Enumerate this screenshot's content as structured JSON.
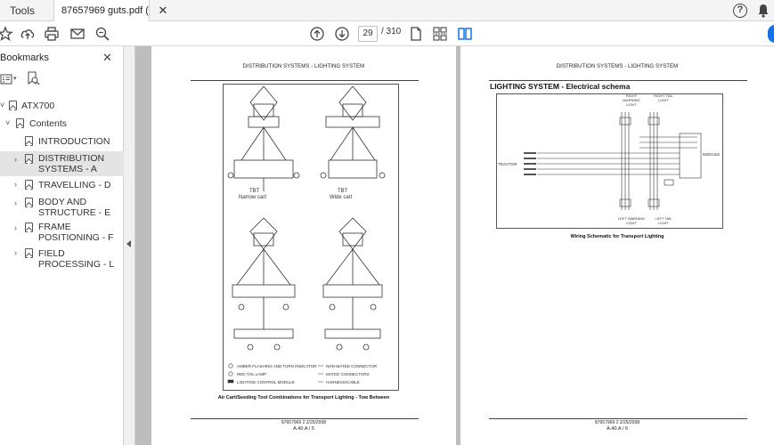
{
  "tabs": {
    "tools_label": "Tools",
    "document_label": "87657969 guts.pdf (..."
  },
  "toolbar": {
    "current_page": "29",
    "total_pages": "/ 310"
  },
  "sidebar": {
    "title": "Bookmarks",
    "items": [
      {
        "label": "ATX700"
      },
      {
        "label": "Contents"
      },
      {
        "label": "INTRODUCTION"
      },
      {
        "label": "DISTRIBUTION SYSTEMS - A"
      },
      {
        "label": "TRAVELLING - D"
      },
      {
        "label": "BODY AND STRUCTURE - E"
      },
      {
        "label": "FRAME POSITIONING - F"
      },
      {
        "label": "FIELD PROCESSING - L"
      }
    ]
  },
  "left_page": {
    "header": "DISTRIBUTION SYSTEMS - LIGHTING SYSTEM",
    "label_narrow_1": "TBT",
    "label_narrow_2": "Narrow cart",
    "label_wide_1": "TBT",
    "label_wide_2": "Wide cart",
    "legend": {
      "amber": "AMBER FLASHING AND TURN INDICATOR",
      "red": "RED TAIL LAMP",
      "module": "LIGHTING CONTROL MODULE",
      "non_mated": "NON-MATED CONNECTOR",
      "mated": "MATED CONNECTORS",
      "harness": "HARNESS/CABLE"
    },
    "caption": "Air Cart/Seeding Tool Combinations for Transport Lighting - Tow Between",
    "footer_code": "87657969 2 2/25/2008",
    "footer_page": "A.40.A / 5"
  },
  "right_page": {
    "header": "DISTRIBUTION SYSTEMS - LIGHTING SYSTEM",
    "section_title": "LIGHTING SYSTEM - Electrical schema",
    "labels": {
      "right_warning": "RIGHT WARNING LIGHT",
      "right_tail": "RIGHT TAIL LIGHT",
      "left_warning": "LEFT WARNING LIGHT",
      "left_tail": "LEFT TAIL LIGHT",
      "module": "MODULE",
      "tractor": "TRACTOR"
    },
    "caption": "Wiring Schematic for Transport Lighting",
    "footer_code": "87657969 2 2/25/2008",
    "footer_page": "A.40.A / 6"
  },
  "colors": {
    "accent": "#1473e6",
    "doc_background": "#bdbdbd",
    "selected_row": "#e4e4e4"
  }
}
